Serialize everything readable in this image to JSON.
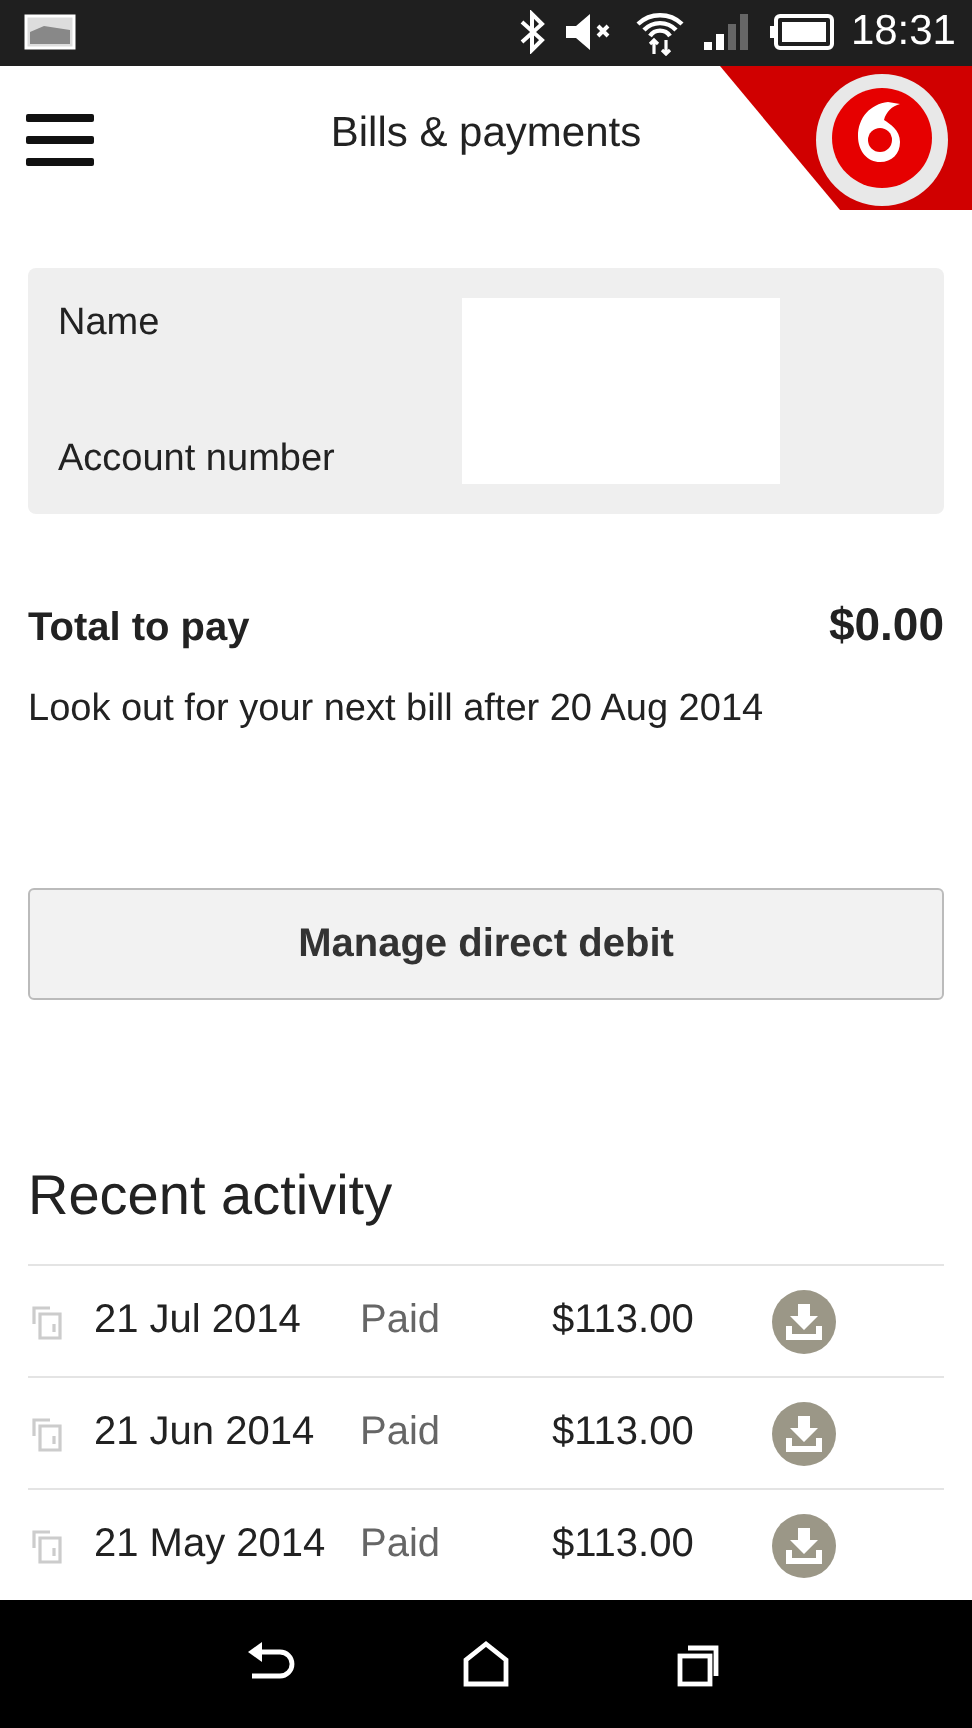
{
  "status_bar": {
    "time": "18:31"
  },
  "header": {
    "title": "Bills & payments"
  },
  "account": {
    "fields": [
      {
        "label": "Name"
      },
      {
        "label": "Account number"
      }
    ]
  },
  "total": {
    "label": "Total to pay",
    "amount": "$0.00",
    "note": "Look out for your next bill after 20 Aug 2014"
  },
  "action_button": {
    "label": "Manage direct debit"
  },
  "recent_activity": {
    "title": "Recent activity",
    "rows": [
      {
        "date": "21 Jul 2014",
        "status": "Paid",
        "amount": "$113.00"
      },
      {
        "date": "21 Jun 2014",
        "status": "Paid",
        "amount": "$113.00"
      },
      {
        "date": "21 May 2014",
        "status": "Paid",
        "amount": "$113.00"
      }
    ]
  }
}
